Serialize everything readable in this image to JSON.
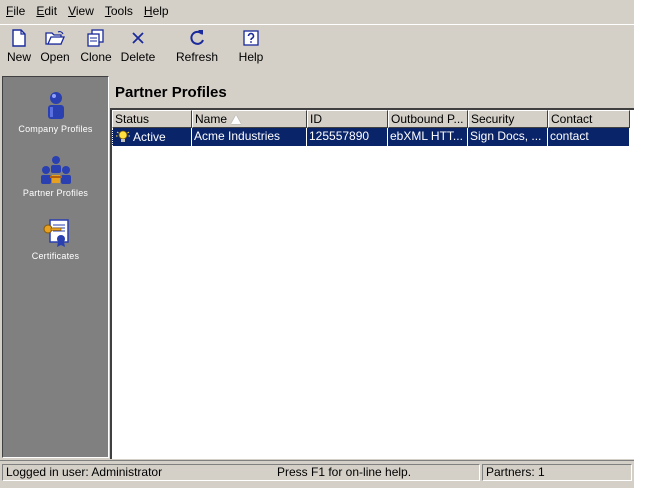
{
  "menubar": {
    "items": [
      {
        "label": "File",
        "u": "F",
        "rest": "ile"
      },
      {
        "label": "Edit",
        "u": "E",
        "rest": "dit"
      },
      {
        "label": "View",
        "u": "V",
        "rest": "iew"
      },
      {
        "label": "Tools",
        "u": "T",
        "rest": "ools"
      },
      {
        "label": "Help",
        "u": "H",
        "rest": "elp"
      }
    ]
  },
  "toolbar": {
    "new_label": "New",
    "open_label": "Open",
    "clone_label": "Clone",
    "delete_label": "Delete",
    "refresh_label": "Refresh",
    "help_label": "Help"
  },
  "sidebar": {
    "items": [
      {
        "label": "Company Profiles",
        "icon": "company-profiles-icon"
      },
      {
        "label": "Partner Profiles",
        "icon": "partner-profiles-icon"
      },
      {
        "label": "Certificates",
        "icon": "certificates-icon"
      }
    ]
  },
  "main": {
    "title": "Partner Profiles",
    "columns": [
      "Status",
      "Name",
      "ID",
      "Outbound P...",
      "Security",
      "Contact"
    ],
    "sorted_column": "Name",
    "rows": [
      {
        "status": "Active",
        "name": "Acme Industries",
        "id": "125557890",
        "outbound": "ebXML HTT...",
        "security": "Sign Docs, ...",
        "contact": "contact",
        "selected": true
      }
    ]
  },
  "statusbar": {
    "user": "Logged in user:  Administrator",
    "help": "Press F1 for on-line help.",
    "count": "Partners: 1"
  },
  "colors": {
    "window_bg": "#d4d0c8",
    "nav_bg": "#808080",
    "selection": "#0a246a",
    "icon_blue": "#2a3fb0"
  }
}
